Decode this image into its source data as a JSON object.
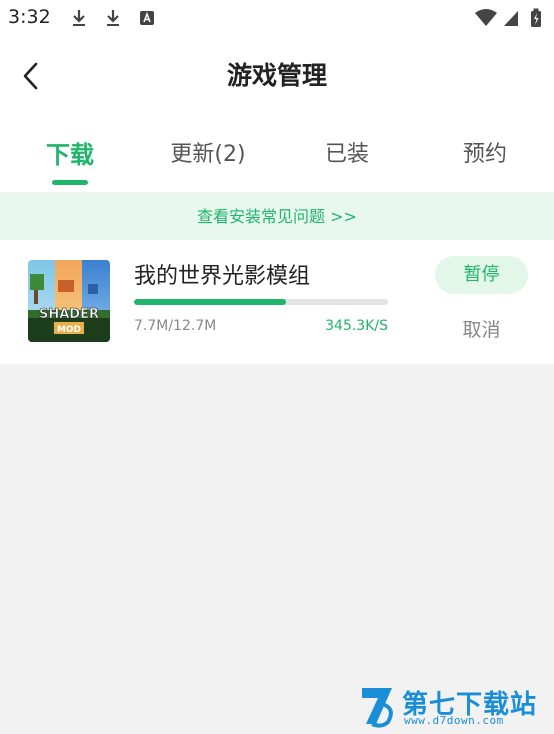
{
  "status_bar": {
    "time": "3:32",
    "left_icons": [
      "download-icon",
      "download-icon",
      "text-notification-icon"
    ],
    "right_icons": [
      "wifi-icon",
      "signal-icon",
      "battery-icon"
    ]
  },
  "nav": {
    "back_icon": "chevron-left-icon",
    "title": "游戏管理"
  },
  "tabs": [
    {
      "label": "下载",
      "active": true
    },
    {
      "label": "更新(2)",
      "active": false
    },
    {
      "label": "已装",
      "active": false
    },
    {
      "label": "预约",
      "active": false
    }
  ],
  "faq_banner": "查看安装常见问题 >>",
  "downloads": [
    {
      "name": "我的世界光影模组",
      "icon_text_1": "SHADER",
      "icon_text_2": "MOD",
      "size": "7.7M/12.7M",
      "speed": "345.3K/S",
      "progress": 0.6,
      "pause_label": "暂停",
      "cancel_label": "取消"
    }
  ],
  "watermark": {
    "title": "第七下载站",
    "url": "www.d7down.com"
  },
  "colors": {
    "accent": "#1fb56a",
    "banner_bg": "#e9f8ef",
    "page_bg": "#f2f2f2",
    "watermark": "#1a8fd8"
  }
}
